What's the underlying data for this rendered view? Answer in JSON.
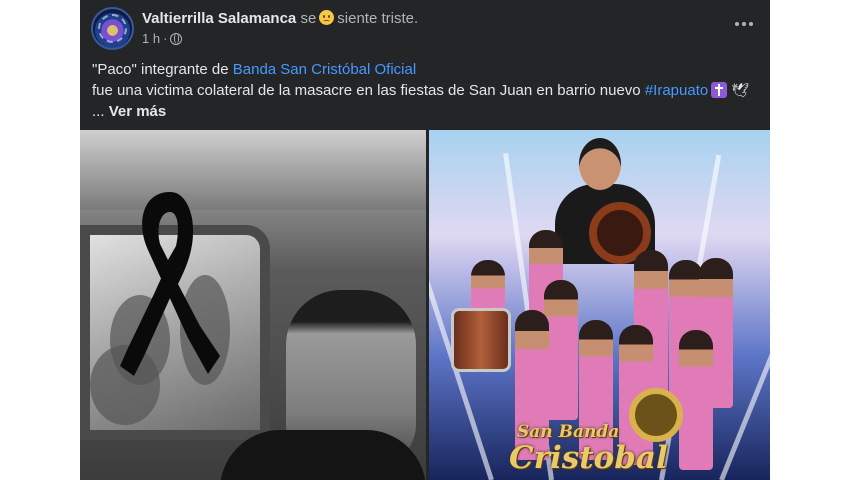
{
  "post": {
    "author": "Valtierrilla Salamanca",
    "feeling_prefix": "se",
    "feeling": "siente triste.",
    "timestamp": "1 h",
    "separator": "·",
    "icons": {
      "more": "more-options-icon",
      "privacy": "globe-icon",
      "feeling": "sad-face-icon"
    }
  },
  "body": {
    "line1_prefix": "\"Paco\" integrante de",
    "mention": "Banda San Cristóbal Oficial",
    "line2_text": "fue una victima colateral de la masacre en las fiestas de San Juan en barrio nuevo",
    "hashtag": "#Irapuato",
    "see_more_prefix": "...",
    "see_more": "Ver más"
  },
  "photos": {
    "right_logo_line1": "San Banda",
    "right_logo_line2": "Cristobal"
  },
  "colors": {
    "card": "#242526",
    "text": "#e4e6eb",
    "secondary": "#b0b3b8",
    "link": "#4599ff"
  }
}
